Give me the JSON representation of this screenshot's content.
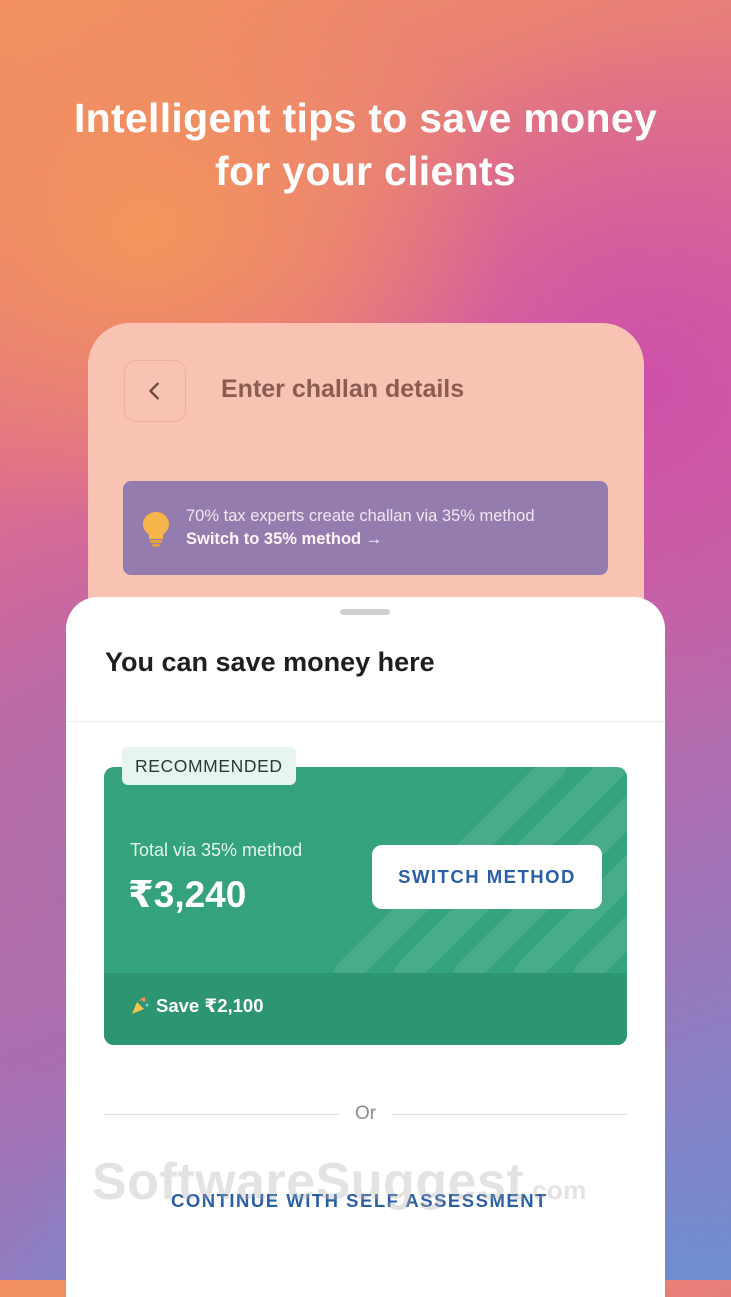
{
  "headline": {
    "line1": "Intelligent tips to save money",
    "line2": "for your clients"
  },
  "challan_screen": {
    "back_icon": "chevron-left-icon",
    "title": "Enter challan details",
    "tip": {
      "icon": "lightbulb-icon",
      "text": "70% tax experts create challan via 35% method",
      "link": "Switch to 35% method →"
    }
  },
  "sheet": {
    "title": "You can save money here",
    "recommended": {
      "badge": "RECOMMENDED",
      "total_label": "Total via 35% method",
      "total_value": "₹3,240",
      "switch_button": "SWITCH METHOD",
      "save_icon": "party-popper-icon",
      "save_text": "Save ₹2,100"
    },
    "or_label": "Or",
    "self_assessment_button": "CONTINUE WITH SELF ASSESSMENT"
  },
  "watermark": {
    "brand": "SoftwareSuggest",
    "suffix": ".com"
  },
  "colors": {
    "card_green": "#34a37b",
    "footer_green": "#2d956f",
    "link_blue": "#2a5fa6",
    "tip_purple": "#957cae",
    "phone_peach": "#f8c3b3"
  }
}
